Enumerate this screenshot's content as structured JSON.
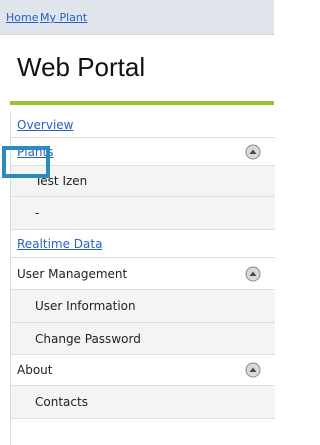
{
  "breadcrumb": {
    "home": "Home",
    "plant": "My Plant"
  },
  "page_title": "Web Portal",
  "menu": {
    "overview": "Overview",
    "plants": "Plants",
    "plant_items": [
      "Test Izen",
      "-"
    ],
    "realtime": "Realtime Data",
    "user_management": "User Management",
    "user_items": [
      "User Information",
      "Change Password"
    ],
    "about": "About",
    "about_items": [
      "Contacts"
    ]
  },
  "icons": {
    "collapse": "collapse-arrow-icon"
  },
  "colors": {
    "link": "#2a5fc7",
    "accent_rule": "#9ec13a",
    "highlight": "#2a8bbd"
  }
}
